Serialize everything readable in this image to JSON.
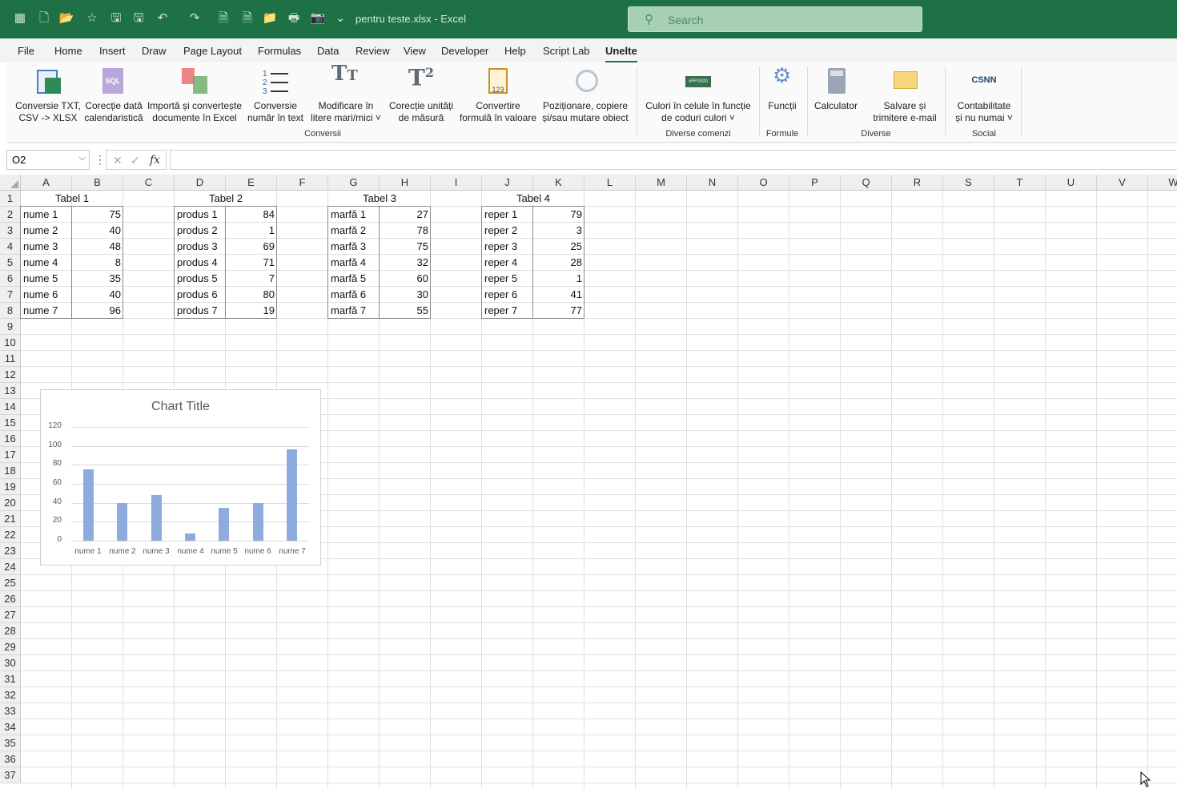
{
  "titlebar": {
    "doc_title": "pentru teste.xlsx  -  Excel",
    "search_placeholder": "Search",
    "qat_icons": [
      "excel-logo-icon",
      "new-file-icon",
      "open-folder-icon",
      "favorite-icon",
      "save-icon",
      "save-as-icon",
      "undo-icon",
      "redo-icon",
      "page-icon",
      "page-icon",
      "folder-icon",
      "print-icon",
      "camera-icon",
      "customize-icon"
    ]
  },
  "menu": {
    "tabs": [
      "File",
      "Home",
      "Insert",
      "Draw",
      "Page Layout",
      "Formulas",
      "Data",
      "Review",
      "View",
      "Developer",
      "Help",
      "Script Lab",
      "Unelte"
    ],
    "active": "Unelte"
  },
  "ribbon": {
    "buttons": [
      {
        "l1": "Conversie TXT,",
        "l2": "CSV -> XLSX",
        "icon": "csv-convert-icon"
      },
      {
        "l1": "Corecție dată",
        "l2": "calendaristică",
        "icon": "sql-icon"
      },
      {
        "l1": "Importă și convertește",
        "l2": "documente în Excel",
        "icon": "import-docs-icon"
      },
      {
        "l1": "Conversie",
        "l2": "număr în text",
        "icon": "numbered-list-icon"
      },
      {
        "l1": "Modificare în",
        "l2": "litere mari/mici ˅",
        "icon": "text-case-icon"
      },
      {
        "l1": "Corecție unități",
        "l2": "de măsură",
        "icon": "superscript-icon"
      },
      {
        "l1": "Convertire",
        "l2": "formulă în valoare",
        "icon": "clipboard-123-icon"
      },
      {
        "l1": "Poziționare, copiere",
        "l2": "și/sau mutare obiect",
        "icon": "hexagon-icon"
      },
      {
        "l1": "Culori în celule în funcție",
        "l2": "de coduri culori ˅",
        "icon": "color-code-icon"
      },
      {
        "l1": "Funcții",
        "l2": "",
        "icon": "gears-icon"
      },
      {
        "l1": "Calculator",
        "l2": "",
        "icon": "calculator-icon"
      },
      {
        "l1": "Salvare și",
        "l2": "trimitere e-mail",
        "icon": "email-icon"
      },
      {
        "l1": "Contabilitate",
        "l2": "și nu numai ˅",
        "icon": "csnn-logo-icon"
      }
    ],
    "groups": [
      "Conversii",
      "Diverse comenzi",
      "Formule",
      "Diverse",
      "Social"
    ],
    "csnn_text": "CSNN"
  },
  "formula_bar": {
    "name_box": "O2",
    "formula": ""
  },
  "columns": [
    "A",
    "B",
    "C",
    "D",
    "E",
    "F",
    "G",
    "H",
    "I",
    "J",
    "K",
    "L",
    "M",
    "N",
    "O",
    "P",
    "Q",
    "R",
    "S",
    "T",
    "U",
    "V",
    "W"
  ],
  "rows": [
    "1",
    "2",
    "3",
    "4",
    "5",
    "6",
    "7",
    "8",
    "9",
    "10",
    "11",
    "12",
    "13",
    "14",
    "15",
    "16",
    "17",
    "18",
    "19",
    "20",
    "21",
    "22",
    "23",
    "24",
    "25",
    "26",
    "27",
    "28",
    "29",
    "30",
    "31",
    "32",
    "33",
    "34",
    "35",
    "36",
    "37"
  ],
  "tables": [
    {
      "title": "Tabel 1",
      "labels": [
        "nume 1",
        "nume 2",
        "nume 3",
        "nume 4",
        "nume 5",
        "nume 6",
        "nume 7"
      ],
      "values": [
        "75",
        "40",
        "48",
        "8",
        "35",
        "40",
        "96"
      ]
    },
    {
      "title": "Tabel 2",
      "labels": [
        "produs 1",
        "produs 2",
        "produs 3",
        "produs 4",
        "produs 5",
        "produs 6",
        "produs 7"
      ],
      "values": [
        "84",
        "1",
        "69",
        "71",
        "7",
        "80",
        "19"
      ]
    },
    {
      "title": "Tabel 3",
      "labels": [
        "marfă 1",
        "marfă 2",
        "marfă 3",
        "marfă 4",
        "marfă 5",
        "marfă 6",
        "marfă 7"
      ],
      "values": [
        "27",
        "78",
        "75",
        "32",
        "60",
        "30",
        "55"
      ]
    },
    {
      "title": "Tabel 4",
      "labels": [
        "reper 1",
        "reper 2",
        "reper 3",
        "reper 4",
        "reper 5",
        "reper 6",
        "reper 7"
      ],
      "values": [
        "79",
        "3",
        "25",
        "28",
        "1",
        "41",
        "77"
      ]
    }
  ],
  "chart_data": {
    "type": "bar",
    "title": "Chart Title",
    "categories": [
      "nume 1",
      "nume 2",
      "nume 3",
      "nume 4",
      "nume 5",
      "nume 6",
      "nume 7"
    ],
    "values": [
      75,
      40,
      48,
      8,
      35,
      40,
      96
    ],
    "ylim": [
      0,
      120
    ],
    "yticks": [
      0,
      20,
      40,
      60,
      80,
      100,
      120
    ],
    "grid": true,
    "bar_color": "#8faadc"
  },
  "colors": {
    "excel_green": "#1e7145"
  }
}
